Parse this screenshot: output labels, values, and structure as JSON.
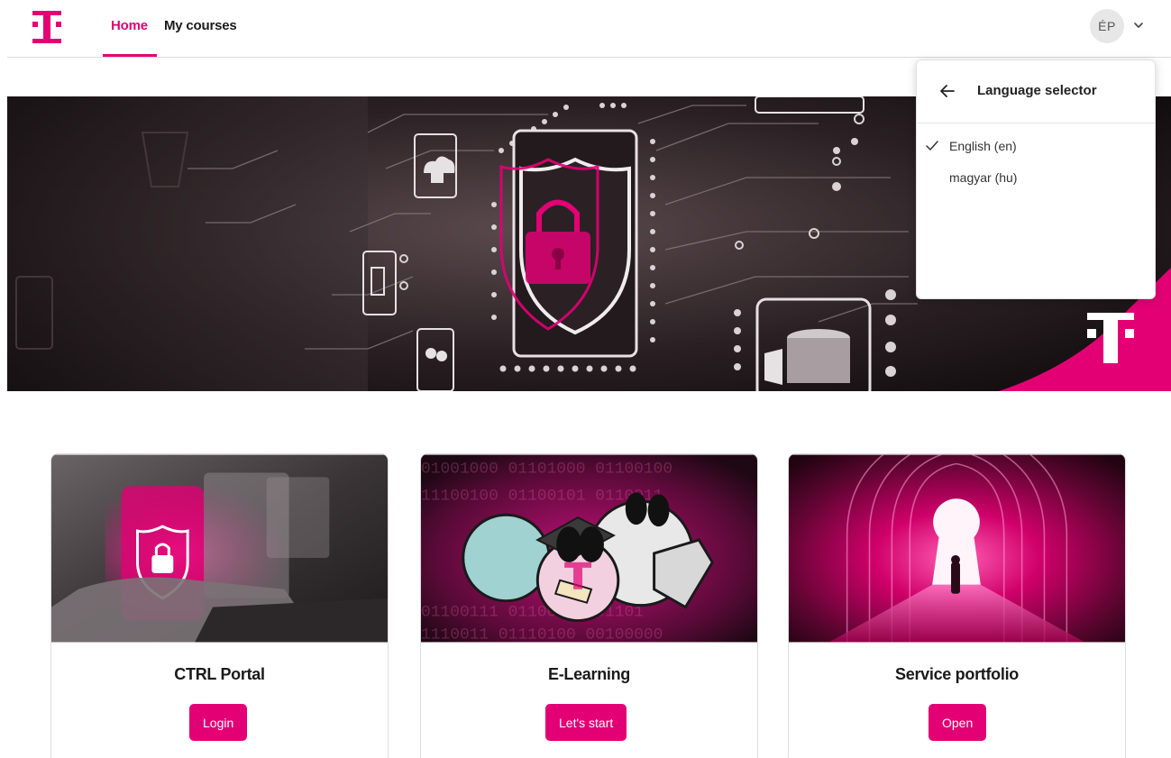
{
  "brand": {
    "logo_letter": "T",
    "accent": "#e20074"
  },
  "nav": {
    "items": [
      {
        "label": "Home",
        "active": true
      },
      {
        "label": "My courses",
        "active": false
      }
    ]
  },
  "user": {
    "initials": "ÉP"
  },
  "language_selector": {
    "title": "Language selector",
    "options": [
      {
        "label": "English (en)",
        "selected": true
      },
      {
        "label": "magyar (hu)",
        "selected": false
      }
    ]
  },
  "cards": [
    {
      "title": "CTRL Portal",
      "button": "Login"
    },
    {
      "title": "E-Learning",
      "button": "Let's start"
    },
    {
      "title": "Service portfolio",
      "button": "Open"
    }
  ]
}
